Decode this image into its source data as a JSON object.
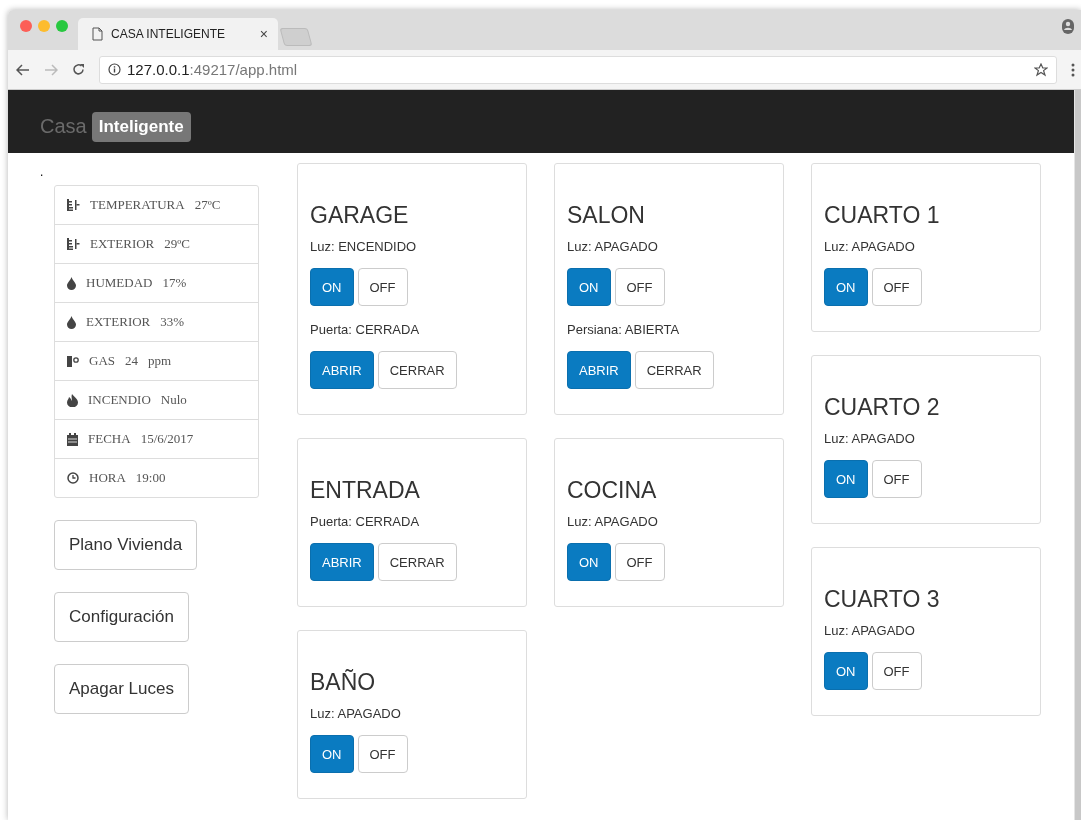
{
  "browser": {
    "tab_title": "CASA INTELIGENTE",
    "tab_close": "×",
    "url_host": "127.0.0.1",
    "url_rest": ":49217/app.html"
  },
  "navbar": {
    "brand": "Casa",
    "badge": "Inteligente"
  },
  "page_dot": ".",
  "sensors": [
    {
      "kind": "temperature",
      "label": "TEMPERATURA",
      "value": "27ºC"
    },
    {
      "kind": "temperature",
      "label": "EXTERIOR",
      "value": "29ºC"
    },
    {
      "kind": "humidity",
      "label": "HUMEDAD",
      "value": "17%"
    },
    {
      "kind": "humidity",
      "label": "EXTERIOR",
      "value": "33%"
    },
    {
      "kind": "gas",
      "label": "GAS",
      "value": "24",
      "unit": "ppm"
    },
    {
      "kind": "fire",
      "label": "INCENDIO",
      "value": "Nulo"
    },
    {
      "kind": "date",
      "label": "FECHA",
      "value": "15/6/2017"
    },
    {
      "kind": "time",
      "label": "HORA",
      "value": "19:00"
    }
  ],
  "side_buttons": [
    "Plano Vivienda",
    "Configuración",
    "Apagar Luces"
  ],
  "columns": [
    {
      "rooms": [
        {
          "title": "GARAGE",
          "controls": [
            {
              "status": "Luz: ENCENDIDO",
              "buttons": [
                {
                  "label": "ON",
                  "kind": "primary"
                },
                {
                  "label": "OFF",
                  "kind": "default"
                }
              ]
            },
            {
              "status": "Puerta: CERRADA",
              "buttons": [
                {
                  "label": "ABRIR",
                  "kind": "primary"
                },
                {
                  "label": "CERRAR",
                  "kind": "default"
                }
              ]
            }
          ]
        },
        {
          "title": "ENTRADA",
          "controls": [
            {
              "status": "Puerta: CERRADA",
              "buttons": [
                {
                  "label": "ABRIR",
                  "kind": "primary"
                },
                {
                  "label": "CERRAR",
                  "kind": "default"
                }
              ]
            }
          ]
        },
        {
          "title": "BAÑO",
          "controls": [
            {
              "status": "Luz: APAGADO",
              "buttons": [
                {
                  "label": "ON",
                  "kind": "primary"
                },
                {
                  "label": "OFF",
                  "kind": "default"
                }
              ]
            }
          ]
        }
      ]
    },
    {
      "rooms": [
        {
          "title": "SALON",
          "controls": [
            {
              "status": "Luz: APAGADO",
              "buttons": [
                {
                  "label": "ON",
                  "kind": "primary"
                },
                {
                  "label": "OFF",
                  "kind": "default"
                }
              ]
            },
            {
              "status": "Persiana: ABIERTA",
              "buttons": [
                {
                  "label": "ABRIR",
                  "kind": "primary"
                },
                {
                  "label": "CERRAR",
                  "kind": "default"
                }
              ]
            }
          ]
        },
        {
          "title": "COCINA",
          "controls": [
            {
              "status": "Luz: APAGADO",
              "buttons": [
                {
                  "label": "ON",
                  "kind": "primary"
                },
                {
                  "label": "OFF",
                  "kind": "default"
                }
              ]
            }
          ]
        }
      ]
    },
    {
      "rooms": [
        {
          "title": "CUARTO 1",
          "controls": [
            {
              "status": "Luz: APAGADO",
              "buttons": [
                {
                  "label": "ON",
                  "kind": "primary"
                },
                {
                  "label": "OFF",
                  "kind": "default"
                }
              ]
            }
          ]
        },
        {
          "title": "CUARTO 2",
          "controls": [
            {
              "status": "Luz: APAGADO",
              "buttons": [
                {
                  "label": "ON",
                  "kind": "primary"
                },
                {
                  "label": "OFF",
                  "kind": "default"
                }
              ]
            }
          ]
        },
        {
          "title": "CUARTO 3",
          "controls": [
            {
              "status": "Luz: APAGADO",
              "buttons": [
                {
                  "label": "ON",
                  "kind": "primary"
                },
                {
                  "label": "OFF",
                  "kind": "default"
                }
              ]
            }
          ]
        }
      ]
    }
  ]
}
